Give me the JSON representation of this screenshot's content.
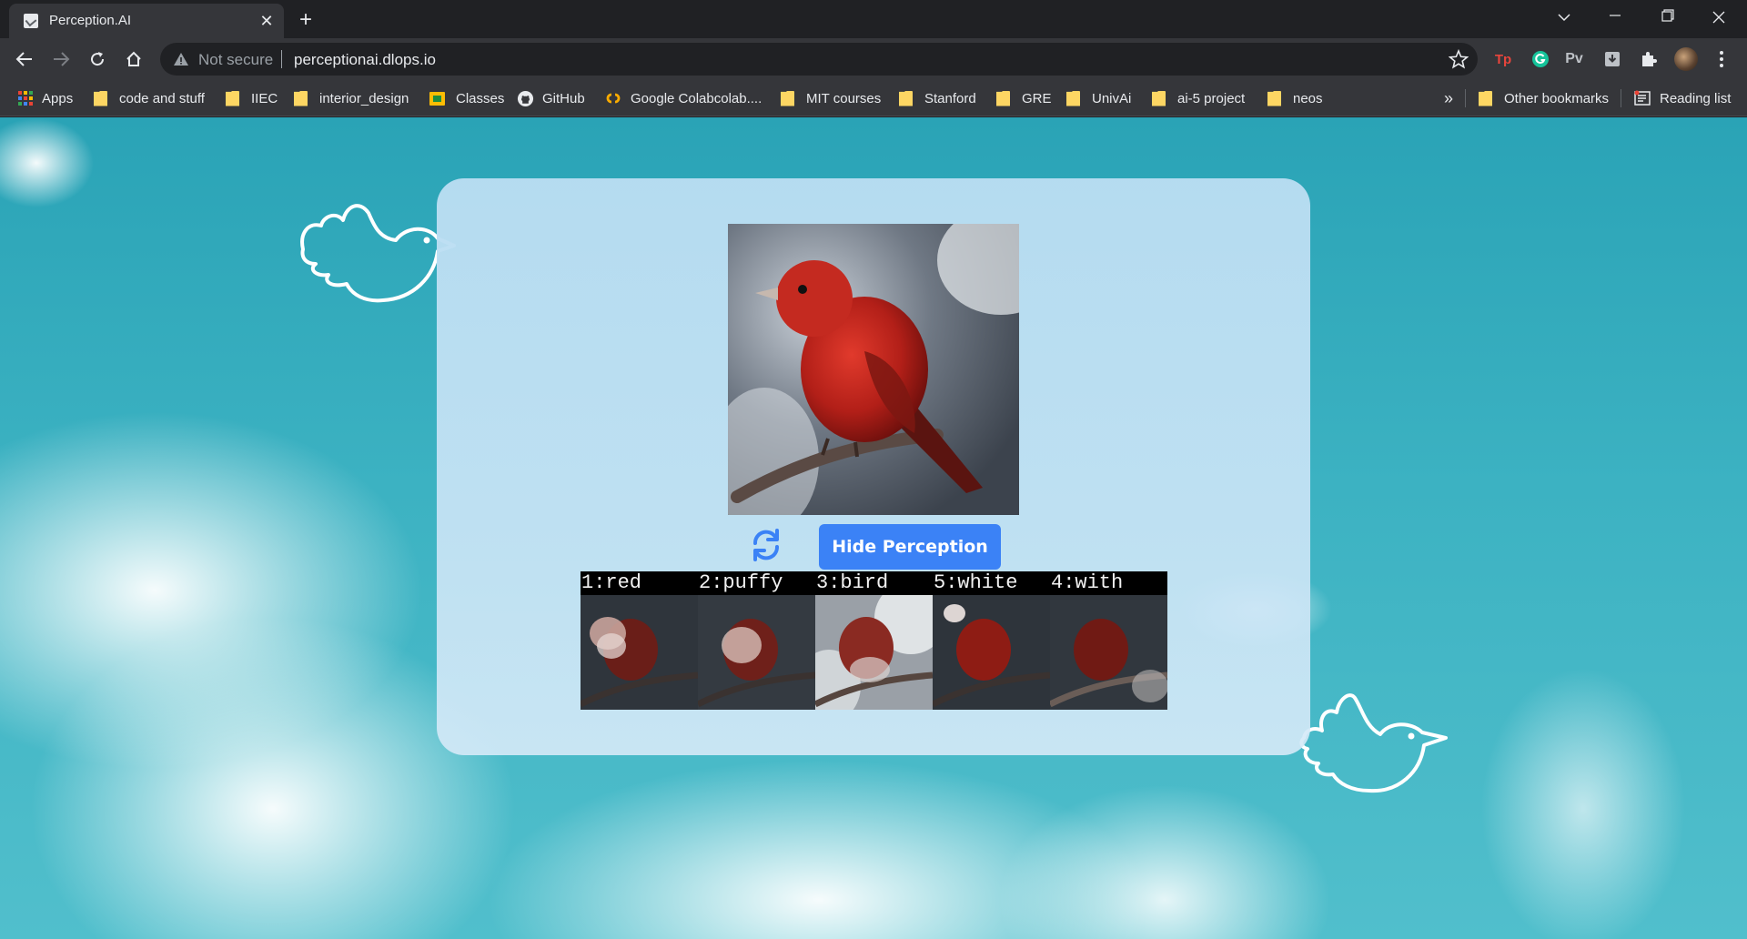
{
  "browser": {
    "tab_title": "Perception.AI",
    "url_security": "Not secure",
    "url": "perceptionai.dlops.io",
    "extensions": {
      "tp": "Tp",
      "pv": "Pv"
    },
    "bookmarks": [
      {
        "label": "Apps"
      },
      {
        "label": "code and stuff"
      },
      {
        "label": "IIEC"
      },
      {
        "label": "interior_design"
      },
      {
        "label": "Classes"
      },
      {
        "label": "GitHub"
      },
      {
        "label": "Google Colabcolab...."
      },
      {
        "label": "MIT courses"
      },
      {
        "label": "Stanford"
      },
      {
        "label": "GRE"
      },
      {
        "label": "UnivAi"
      },
      {
        "label": "ai-5 project"
      },
      {
        "label": "neos"
      }
    ],
    "overflow_label": "»",
    "other_bookmarks": "Other bookmarks",
    "reading_list": "Reading list"
  },
  "page": {
    "button_label": "Hide Perception",
    "perception": [
      {
        "label": "1:red"
      },
      {
        "label": "2:puffy"
      },
      {
        "label": "3:bird"
      },
      {
        "label": "5:white"
      },
      {
        "label": "4:with"
      }
    ]
  },
  "colors": {
    "button": "#3b82f6",
    "refresh_icon": "#3b82f6",
    "folder": "#fdd663"
  }
}
